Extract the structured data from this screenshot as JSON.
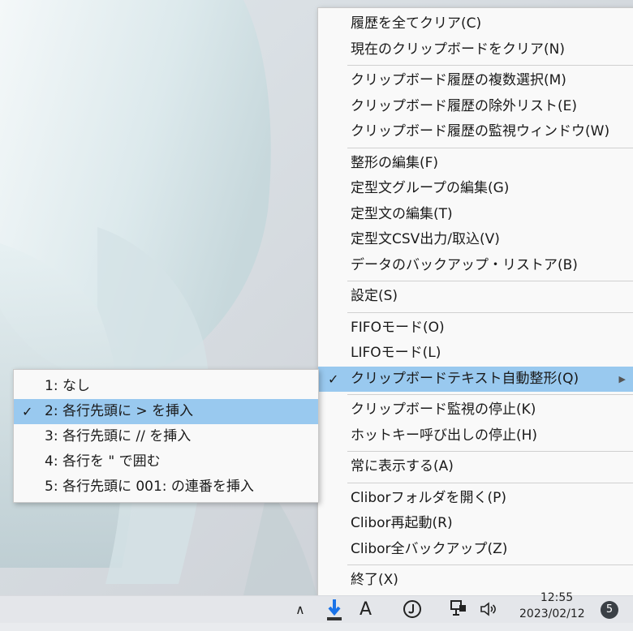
{
  "main_menu": {
    "items": [
      {
        "label": "履歴を全てクリア(C)"
      },
      {
        "label": "現在のクリップボードをクリア(N)"
      },
      {
        "sep": true
      },
      {
        "label": "クリップボード履歴の複数選択(M)"
      },
      {
        "label": "クリップボード履歴の除外リスト(E)"
      },
      {
        "label": "クリップボード履歴の監視ウィンドウ(W)"
      },
      {
        "sep": true
      },
      {
        "label": "整形の編集(F)"
      },
      {
        "label": "定型文グループの編集(G)"
      },
      {
        "label": "定型文の編集(T)"
      },
      {
        "label": "定型文CSV出力/取込(V)"
      },
      {
        "label": "データのバックアップ・リストア(B)"
      },
      {
        "sep": true
      },
      {
        "label": "設定(S)"
      },
      {
        "sep": true
      },
      {
        "label": "FIFOモード(O)"
      },
      {
        "label": "LIFOモード(L)"
      },
      {
        "label": "クリップボードテキスト自動整形(Q)",
        "checked": true,
        "highlight": true,
        "submenu": true
      },
      {
        "sep": true
      },
      {
        "label": "クリップボード監視の停止(K)"
      },
      {
        "label": "ホットキー呼び出しの停止(H)"
      },
      {
        "sep": true
      },
      {
        "label": "常に表示する(A)"
      },
      {
        "sep": true
      },
      {
        "label": "Cliborフォルダを開く(P)"
      },
      {
        "label": "Clibor再起動(R)"
      },
      {
        "label": "Clibor全バックアップ(Z)"
      },
      {
        "sep": true
      },
      {
        "label": "終了(X)"
      }
    ]
  },
  "sub_menu": {
    "items": [
      {
        "label": "1: なし"
      },
      {
        "label": "2: 各行先頭に > を挿入",
        "checked": true,
        "highlight": true
      },
      {
        "label": "3: 各行先頭に // を挿入"
      },
      {
        "label": "4: 各行を \" で囲む"
      },
      {
        "label": "5: 各行先頭に 001: の連番を挿入"
      }
    ]
  },
  "taskbar": {
    "chevron": "∧",
    "ime": "A",
    "time": "12:55",
    "date": "2023/02/12",
    "notifications": "5"
  },
  "glyphs": {
    "check": "✓",
    "arrow": "▶"
  }
}
